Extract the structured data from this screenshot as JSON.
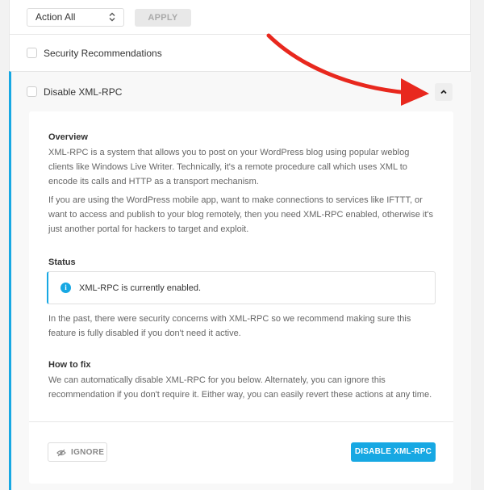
{
  "toolbar": {
    "bulk_action_selected": "Action All",
    "apply_label": "APPLY"
  },
  "rows": [
    {
      "label": "Security Recommendations"
    },
    {
      "label": "Disable XML-RPC"
    }
  ],
  "panel": {
    "overview_title": "Overview",
    "overview_p1": "XML-RPC is a system that allows you to post on your WordPress blog using popular weblog clients like Windows Live Writer. Technically, it's a remote procedure call which uses XML to encode its calls and HTTP as a transport mechanism.",
    "overview_p2": "If you are using the WordPress mobile app, want to make connections to services like IFTTT, or want to access and publish to your blog remotely, then you need XML-RPC enabled, otherwise it's just another portal for hackers to target and exploit.",
    "status_title": "Status",
    "status_notice": "XML-RPC is currently enabled.",
    "status_p": "In the past, there were security concerns with XML-RPC so we recommend making sure this feature is fully disabled if you don't need it active.",
    "howto_title": "How to fix",
    "howto_p": "We can automatically disable XML-RPC for you below. Alternately, you can ignore this recommendation if you don't require it. Either way, you can easily revert these actions at any time.",
    "ignore_label": "IGNORE",
    "disable_label": "DISABLE XML-RPC"
  },
  "colors": {
    "accent": "#17a8e3",
    "annotation_arrow": "#e8281e"
  },
  "icons": {
    "select_chevron": "chevron-updown-icon",
    "collapse": "chevron-up-icon",
    "notice": "info-icon",
    "ignore": "eye-slash-icon"
  }
}
